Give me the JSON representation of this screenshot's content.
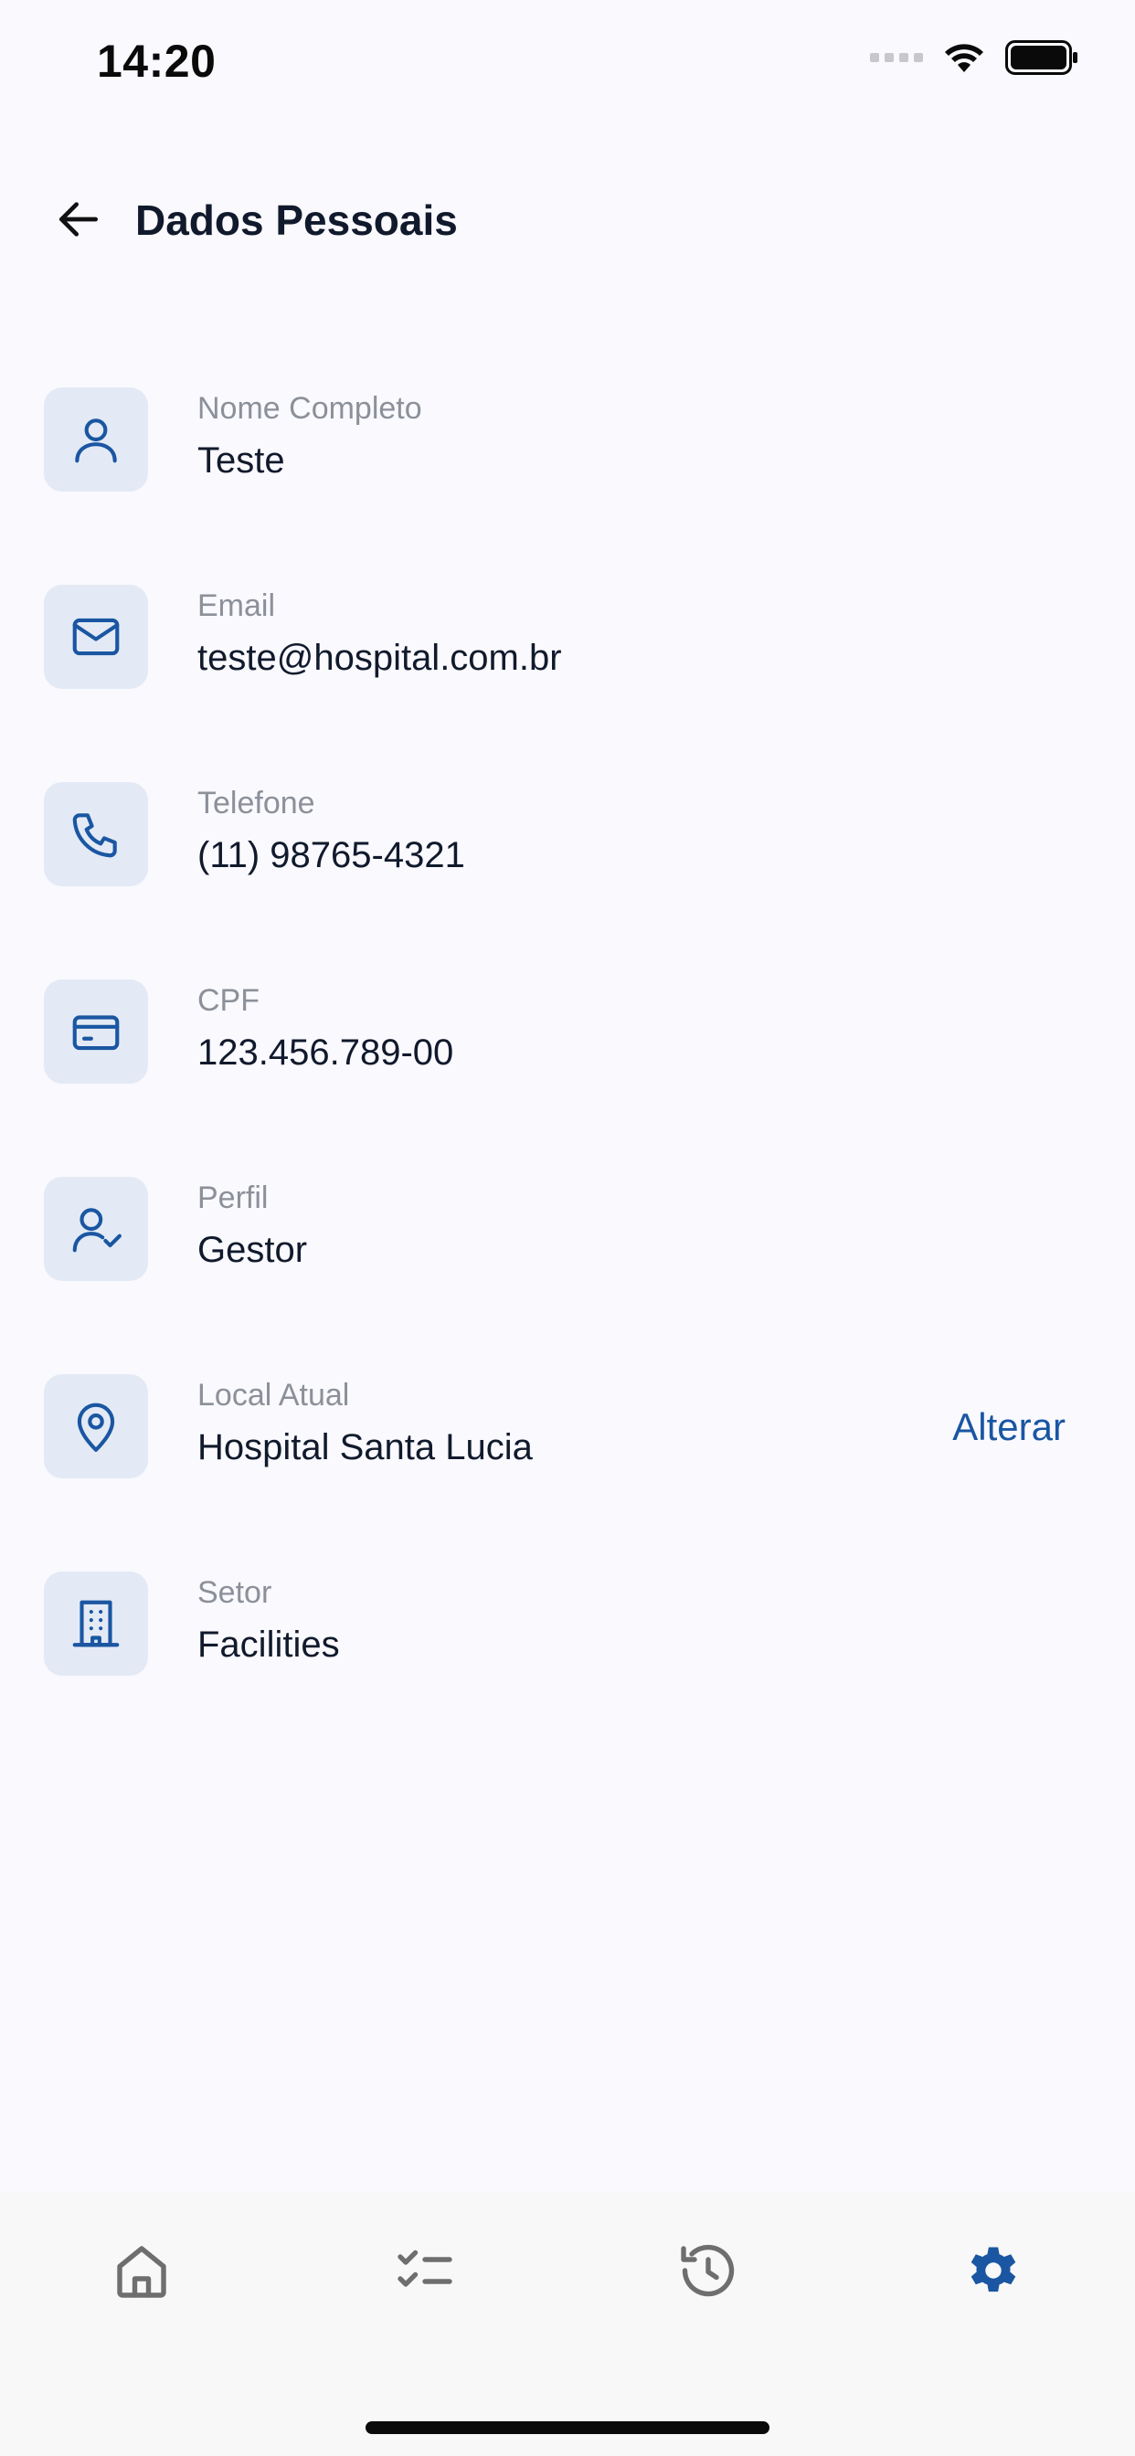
{
  "status_bar": {
    "time": "14:20"
  },
  "header": {
    "title": "Dados Pessoais"
  },
  "fields": [
    {
      "label": "Nome Completo",
      "value": "Teste",
      "icon": "user-icon"
    },
    {
      "label": "Email",
      "value": "teste@hospital.com.br",
      "icon": "mail-icon"
    },
    {
      "label": "Telefone",
      "value": "(11) 98765-4321",
      "icon": "phone-icon"
    },
    {
      "label": "CPF",
      "value": "123.456.789-00",
      "icon": "card-icon"
    },
    {
      "label": "Perfil",
      "value": "Gestor",
      "icon": "user-check-icon"
    },
    {
      "label": "Local Atual",
      "value": "Hospital Santa Lucia",
      "icon": "map-pin-icon",
      "action": "Alterar"
    },
    {
      "label": "Setor",
      "value": "Facilities",
      "icon": "building-icon"
    }
  ],
  "bottom_nav": {
    "items": [
      "home-icon",
      "checklist-icon",
      "history-icon",
      "settings-icon"
    ],
    "active": "settings-icon"
  },
  "colors": {
    "accent": "#1a56a2",
    "icon_bg": "#e3eaf5",
    "label": "#8c9099",
    "text": "#111a2c",
    "nav_inactive": "#6e6e6e"
  }
}
